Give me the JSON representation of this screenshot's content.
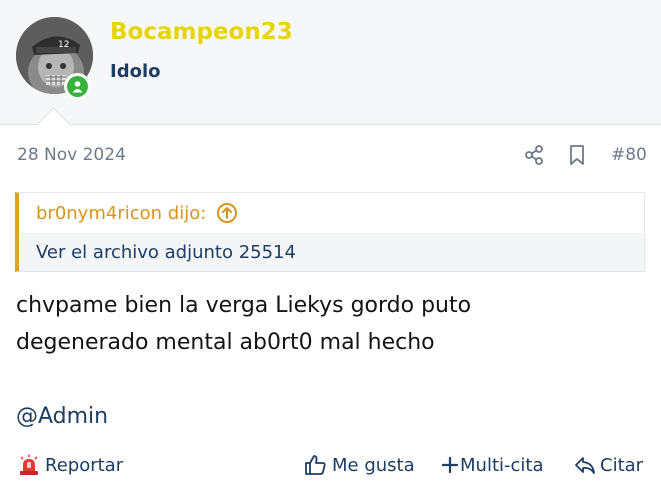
{
  "user": {
    "name": "Bocampeon23",
    "title": "Idolo"
  },
  "post": {
    "date": "28 Nov 2024",
    "number": "#80",
    "quote": {
      "author_line": "br0nym4ricon dijo:",
      "content": "Ver el archivo adjunto 25514"
    },
    "message_line1": "chvpame bien la verga Liekys gordo puto",
    "message_line2": "degenerado mental ab0rt0 mal hecho",
    "mention": "@Admin"
  },
  "actions": {
    "report": "Reportar",
    "like": "Me gusta",
    "multiquote": "Multi-cita",
    "quote": "Citar"
  },
  "colors": {
    "username": "#e8d500",
    "title": "#1d3d63",
    "quote_accent": "#e2a12a",
    "online": "#3ab03e"
  },
  "icons": [
    "share-icon",
    "bookmark-icon",
    "arrow-up-circle-icon",
    "siren-icon",
    "thumbs-up-icon",
    "plus-icon",
    "reply-icon",
    "user-icon"
  ]
}
